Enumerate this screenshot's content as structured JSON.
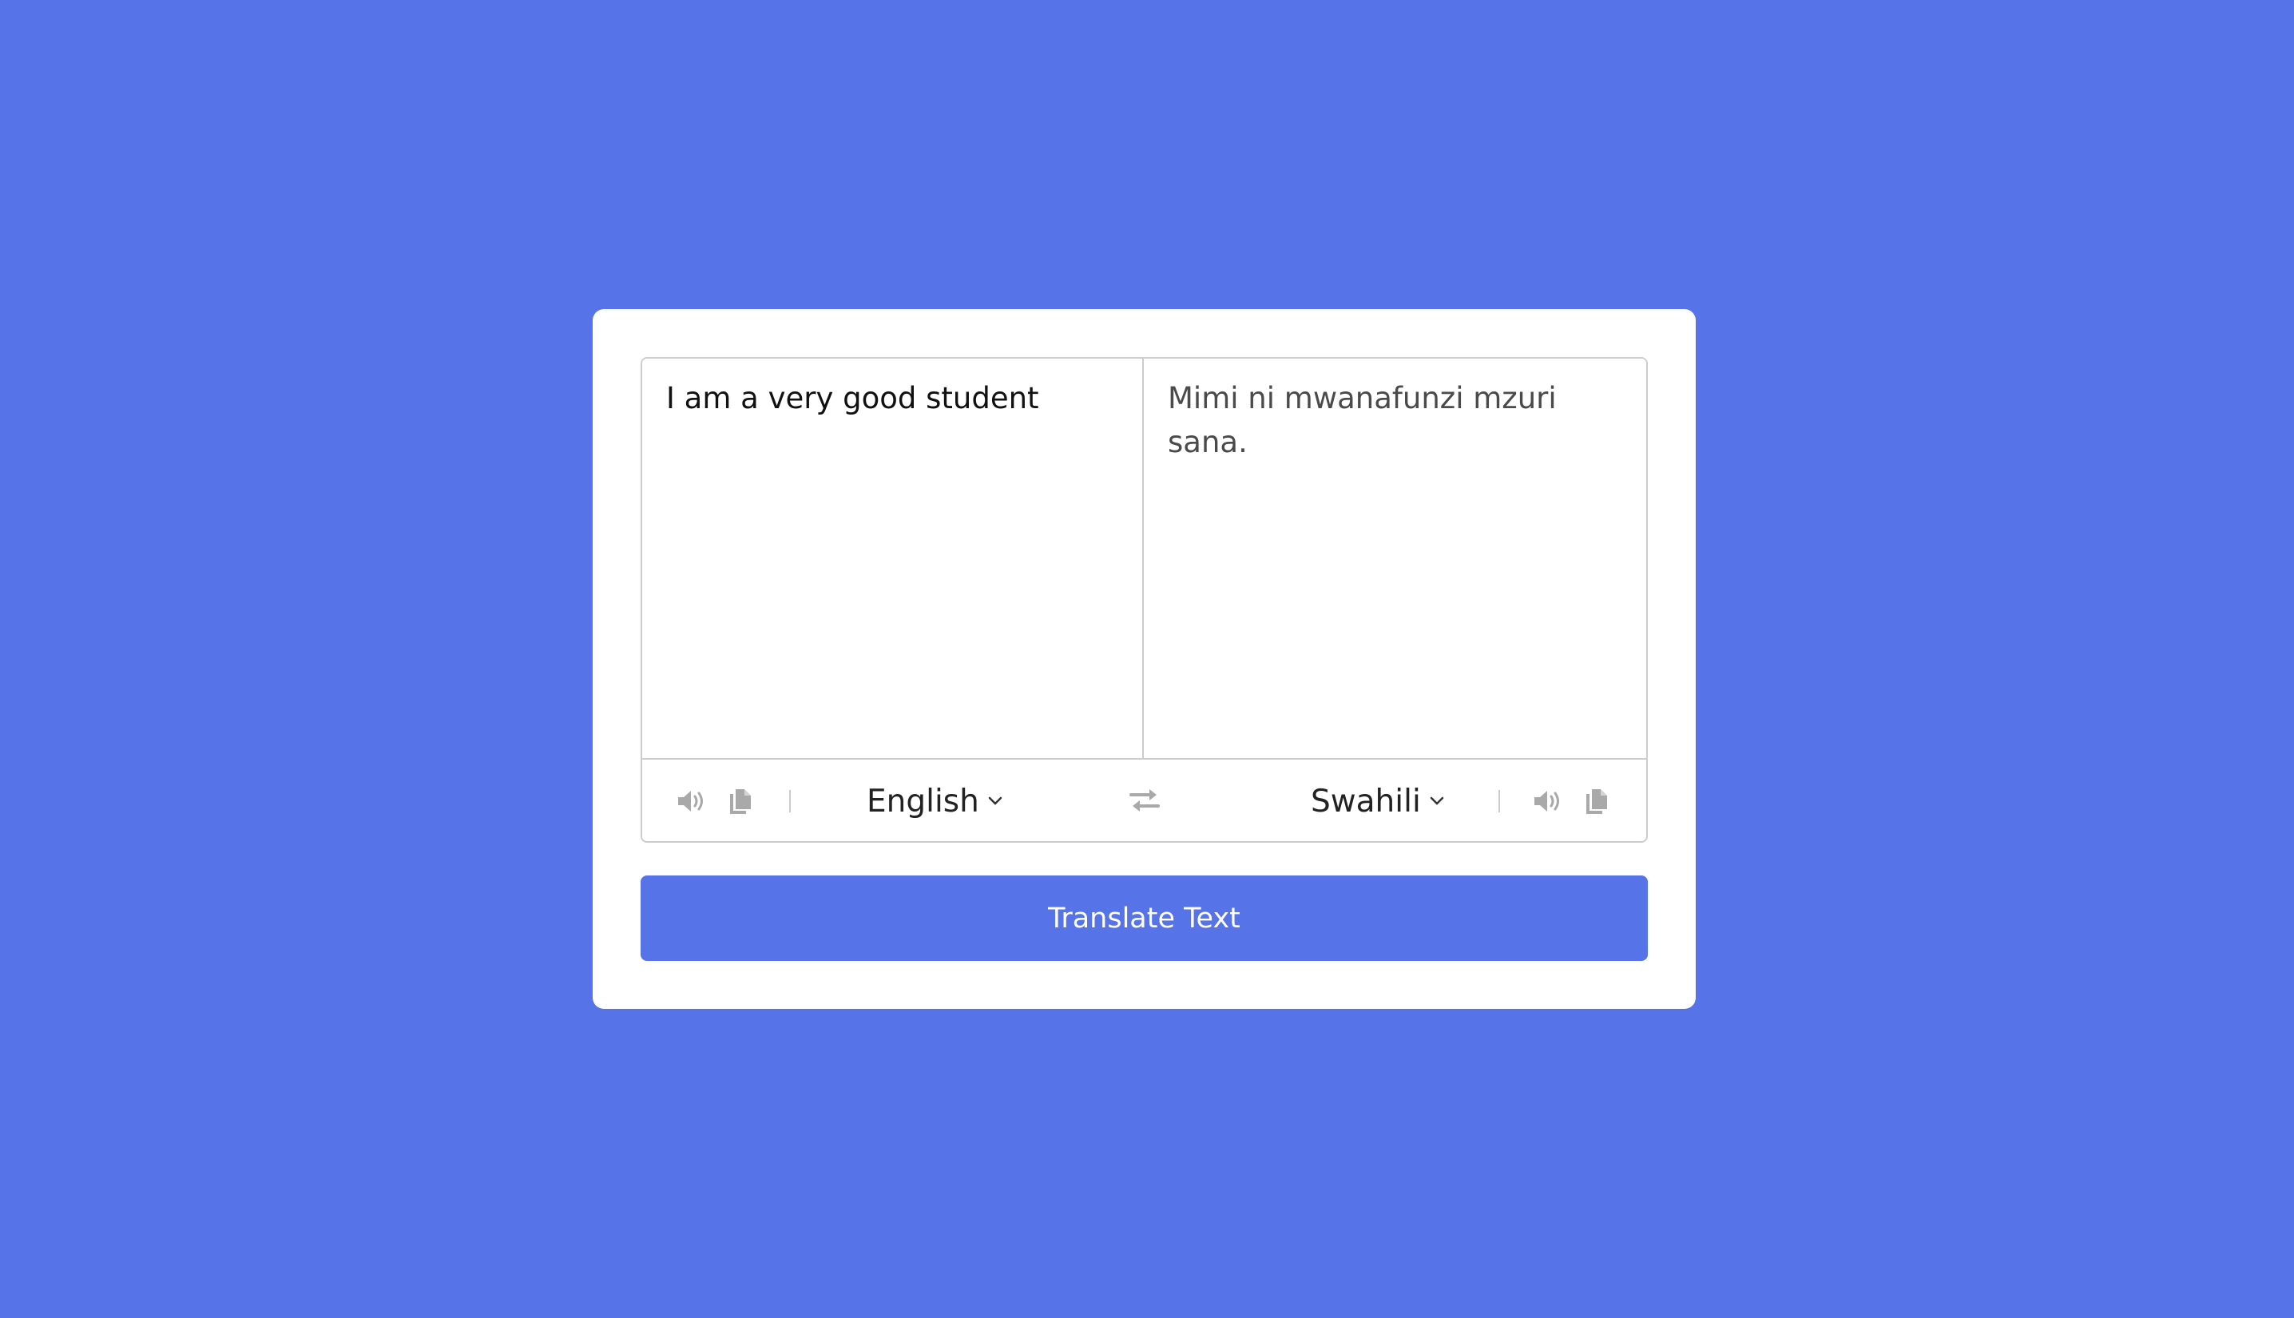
{
  "translator": {
    "source_text": "I am a very good student",
    "translated_text": "Mimi ni mwanafunzi mzuri sana.",
    "from_language": "English",
    "to_language": "Swahili",
    "translate_button_label": "Translate Text"
  },
  "icons": {
    "speaker": "volume-icon",
    "copy": "copy-icon",
    "exchange": "exchange-icon",
    "chevron": "chevron-down-icon"
  },
  "colors": {
    "background": "#5673e8",
    "card": "#ffffff",
    "button": "#5673e8",
    "icon": "#a9a9a9",
    "border": "#cccccc"
  }
}
